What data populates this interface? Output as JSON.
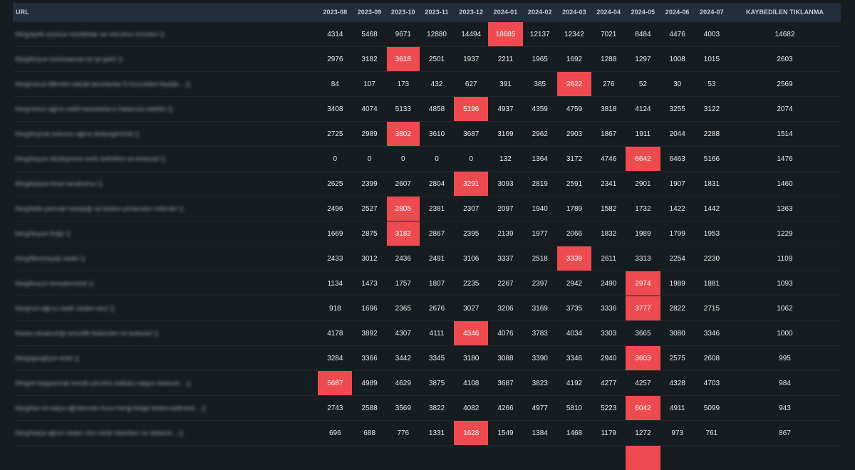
{
  "table": {
    "headers": [
      "URL",
      "2023-08",
      "2023-09",
      "2023-10",
      "2023-11",
      "2023-12",
      "2024-01",
      "2024-02",
      "2024-03",
      "2024-04",
      "2024-05",
      "2024-06",
      "2024-07",
      "KAYBEDİLEN TIKLANMA"
    ],
    "highlight_color": "#ed4b4f",
    "rows": [
      {
        "url": "/blog/aylık-usulsüz-rezidanlar-ve-vücudun-sınırları/ ()",
        "values": [
          "4314",
          "5468",
          "9671",
          "12880",
          "14494",
          "18685",
          "12137",
          "12342",
          "7021",
          "8484",
          "4476",
          "4003"
        ],
        "lost": "14682",
        "highlight": 5
      },
      {
        "url": "/blog/boyun-tutulmasına-ne-iyi-gelir/ ()",
        "values": [
          "2976",
          "3182",
          "3618",
          "2501",
          "1937",
          "2211",
          "1965",
          "1692",
          "1288",
          "1297",
          "1008",
          "1015"
        ],
        "lost": "2603",
        "highlight": 2
      },
      {
        "url": "/blog/vücut-dilimleri-olarak-tanıtılanlar-fi-mucizeleri-faydalı... ()",
        "values": [
          "84",
          "107",
          "173",
          "432",
          "627",
          "391",
          "385",
          "2622",
          "276",
          "52",
          "30",
          "53"
        ],
        "lost": "2569",
        "highlight": 7
      },
      {
        "url": "/blog/omuz-ağrısı-ciddi-hastalıkların-habercisi-olabilir/ ()",
        "values": [
          "3408",
          "4074",
          "5133",
          "4858",
          "5196",
          "4937",
          "4359",
          "4759",
          "3818",
          "4124",
          "3255",
          "3122"
        ],
        "lost": "2074",
        "highlight": 4
      },
      {
        "url": "/blog/kuyruk-sokumu-ağrısı-tedavigöründ/ ()",
        "values": [
          "2725",
          "2989",
          "3802",
          "3610",
          "3687",
          "3169",
          "2962",
          "2903",
          "1867",
          "1911",
          "2044",
          "2288"
        ],
        "lost": "1514",
        "highlight": 2
      },
      {
        "url": "/blog/boyun-düzleşmesi-nedir-belirtileri-ve-tedavisi/ ()",
        "values": [
          "0",
          "0",
          "0",
          "0",
          "0",
          "132",
          "1364",
          "3172",
          "4746",
          "6642",
          "6463",
          "5166"
        ],
        "lost": "1476",
        "highlight": 9
      },
      {
        "url": "/blog/karpal-tünel-sendromu/ ()",
        "values": [
          "2625",
          "2399",
          "2607",
          "2804",
          "3291",
          "3093",
          "2819",
          "2591",
          "2341",
          "2901",
          "1907",
          "1831"
        ],
        "lost": "1460",
        "highlight": 4
      },
      {
        "url": "/blog/tetik-parmak-hastalığı-ve-tedavi-yöntemleri-nelerdir/ ()",
        "values": [
          "2496",
          "2527",
          "2805",
          "2381",
          "2307",
          "2097",
          "1940",
          "1789",
          "1582",
          "1732",
          "1422",
          "1442"
        ],
        "lost": "1363",
        "highlight": 2
      },
      {
        "url": "/blog/boyun-fıtığı/ ()",
        "values": [
          "1669",
          "2875",
          "3182",
          "2867",
          "2395",
          "2139",
          "1977",
          "2066",
          "1832",
          "1989",
          "1799",
          "1953"
        ],
        "lost": "1229",
        "highlight": 2
      },
      {
        "url": "/blog/fibromiyalji-nedir/ ()",
        "values": [
          "2433",
          "3012",
          "2436",
          "2491",
          "3106",
          "3337",
          "2518",
          "3339",
          "2611",
          "3313",
          "2254",
          "2230"
        ],
        "lost": "1109",
        "highlight": 7
      },
      {
        "url": "/blog/boyun-kireçlenmesi/ ()",
        "values": [
          "1134",
          "1473",
          "1757",
          "1807",
          "2235",
          "2267",
          "2397",
          "2942",
          "2490",
          "2974",
          "1989",
          "1881"
        ],
        "lost": "1093",
        "highlight": 9
      },
      {
        "url": "/blog/sırt-ağrısı-nedir-neden-olur/ ()",
        "values": [
          "918",
          "1696",
          "2365",
          "2676",
          "3027",
          "3206",
          "3169",
          "3735",
          "3336",
          "3777",
          "2822",
          "2715"
        ],
        "lost": "1062",
        "highlight": 9
      },
      {
        "url": "/kasta-rahatsızlığı-omurilik-bölümleri-ve-tedavisi/ ()",
        "values": [
          "4178",
          "3892",
          "4307",
          "4111",
          "4346",
          "4076",
          "3783",
          "4034",
          "3303",
          "3665",
          "3080",
          "3346"
        ],
        "lost": "1000",
        "highlight": 4
      },
      {
        "url": "/blog/gangliyon-kisti/ ()",
        "values": [
          "3284",
          "3366",
          "3442",
          "3345",
          "3180",
          "3088",
          "3390",
          "3346",
          "2940",
          "3603",
          "2575",
          "2608"
        ],
        "lost": "995",
        "highlight": 9
      },
      {
        "url": "/blog/el-başparmak-kemik-çıkıntısı-halluks-valgus-tedavisi... ()",
        "values": [
          "5687",
          "4989",
          "4629",
          "3875",
          "4108",
          "3687",
          "3823",
          "4192",
          "4277",
          "4257",
          "4328",
          "4703"
        ],
        "lost": "984",
        "highlight": 0
      },
      {
        "url": "/blog/bel-ve-kalça-ağrılarında-önce-hangi-bölge-tedavi-edilmesi... ()",
        "values": [
          "2743",
          "2588",
          "3569",
          "3822",
          "4082",
          "4266",
          "4977",
          "5810",
          "5223",
          "6042",
          "4911",
          "5099"
        ],
        "lost": "943",
        "highlight": 9
      },
      {
        "url": "/blog/kalça-ağrısı-neden-olur-nedir-belirtileri-ve-tedavisi... ()",
        "values": [
          "696",
          "688",
          "776",
          "1331",
          "1628",
          "1549",
          "1384",
          "1468",
          "1179",
          "1272",
          "973",
          "761"
        ],
        "lost": "867",
        "highlight": 4
      },
      {
        "url": "",
        "values": [
          "",
          "",
          "",
          "",
          "",
          "",
          "",
          "",
          "",
          "",
          "",
          ""
        ],
        "lost": "",
        "highlight": 9
      }
    ]
  }
}
